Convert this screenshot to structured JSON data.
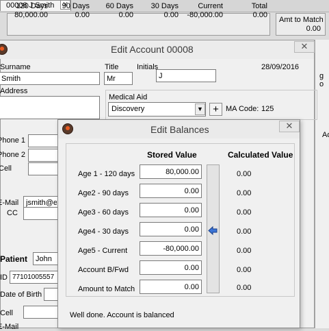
{
  "tab": {
    "label": "00008 J Smith",
    "close": "✕"
  },
  "ageing": {
    "columns": [
      {
        "label": "120 Days",
        "value": "80,000.00"
      },
      {
        "label": "90 Days",
        "value": "0.00"
      },
      {
        "label": "60 Days",
        "value": "0.00"
      },
      {
        "label": "30 Days",
        "value": "0.00"
      },
      {
        "label": "Current",
        "value": "-80,000.00"
      },
      {
        "label": "Total",
        "value": "0.00"
      }
    ],
    "amt_to_match": {
      "label": "Amt to Match",
      "value": "0.00"
    }
  },
  "account_window": {
    "title": "Edit Account 00008",
    "close": "✕",
    "date": "28/09/2016",
    "surname_label": "Surname",
    "surname_value": "Smith",
    "title_label": "Title",
    "title_value": "Mr",
    "initials_label": "Initials",
    "initials_value": "J",
    "address_label": "Address",
    "medical_aid": {
      "label": "Medical Aid",
      "selected": "Discovery",
      "plus": "+",
      "ma_code_label": "MA Code:",
      "ma_code_value": "125"
    },
    "phone1_label": "Phone 1",
    "phone2_label": "Phone 2",
    "cell_label": "Cell",
    "email_label": "E-Mail",
    "email_value": "jsmith@e",
    "cc_label": "CC",
    "patient_label": "Patient",
    "patient_value": "John",
    "id_label": "ID",
    "id_value": "77101005557",
    "dob_label": "Date of Birth",
    "cell2_label": "Cell",
    "email2_label": "E-Mail"
  },
  "right_strip": {
    "text1": "g o",
    "text2": "Ad"
  },
  "balances_window": {
    "title": "Edit Balances",
    "close": "✕",
    "stored_header": "Stored Value",
    "calculated_header": "Calculated Value",
    "rows": [
      {
        "label": "Age 1 - 120 days",
        "stored": "80,000.00",
        "calculated": "0.00"
      },
      {
        "label": "Age2 -  90 days",
        "stored": "0.00",
        "calculated": "0.00"
      },
      {
        "label": "Age3 -  60 days",
        "stored": "0.00",
        "calculated": "0.00"
      },
      {
        "label": "Age4 -  30 days",
        "stored": "0.00",
        "calculated": "0.00"
      },
      {
        "label": "Age5 -  Current",
        "stored": "-80,000.00",
        "calculated": "0.00"
      },
      {
        "label": "Account B/Fwd",
        "stored": "0.00",
        "calculated": "0.00"
      },
      {
        "label": "Amount to Match",
        "stored": "0.00",
        "calculated": "0.00"
      }
    ],
    "status_message": "Well done. Account is balanced"
  }
}
